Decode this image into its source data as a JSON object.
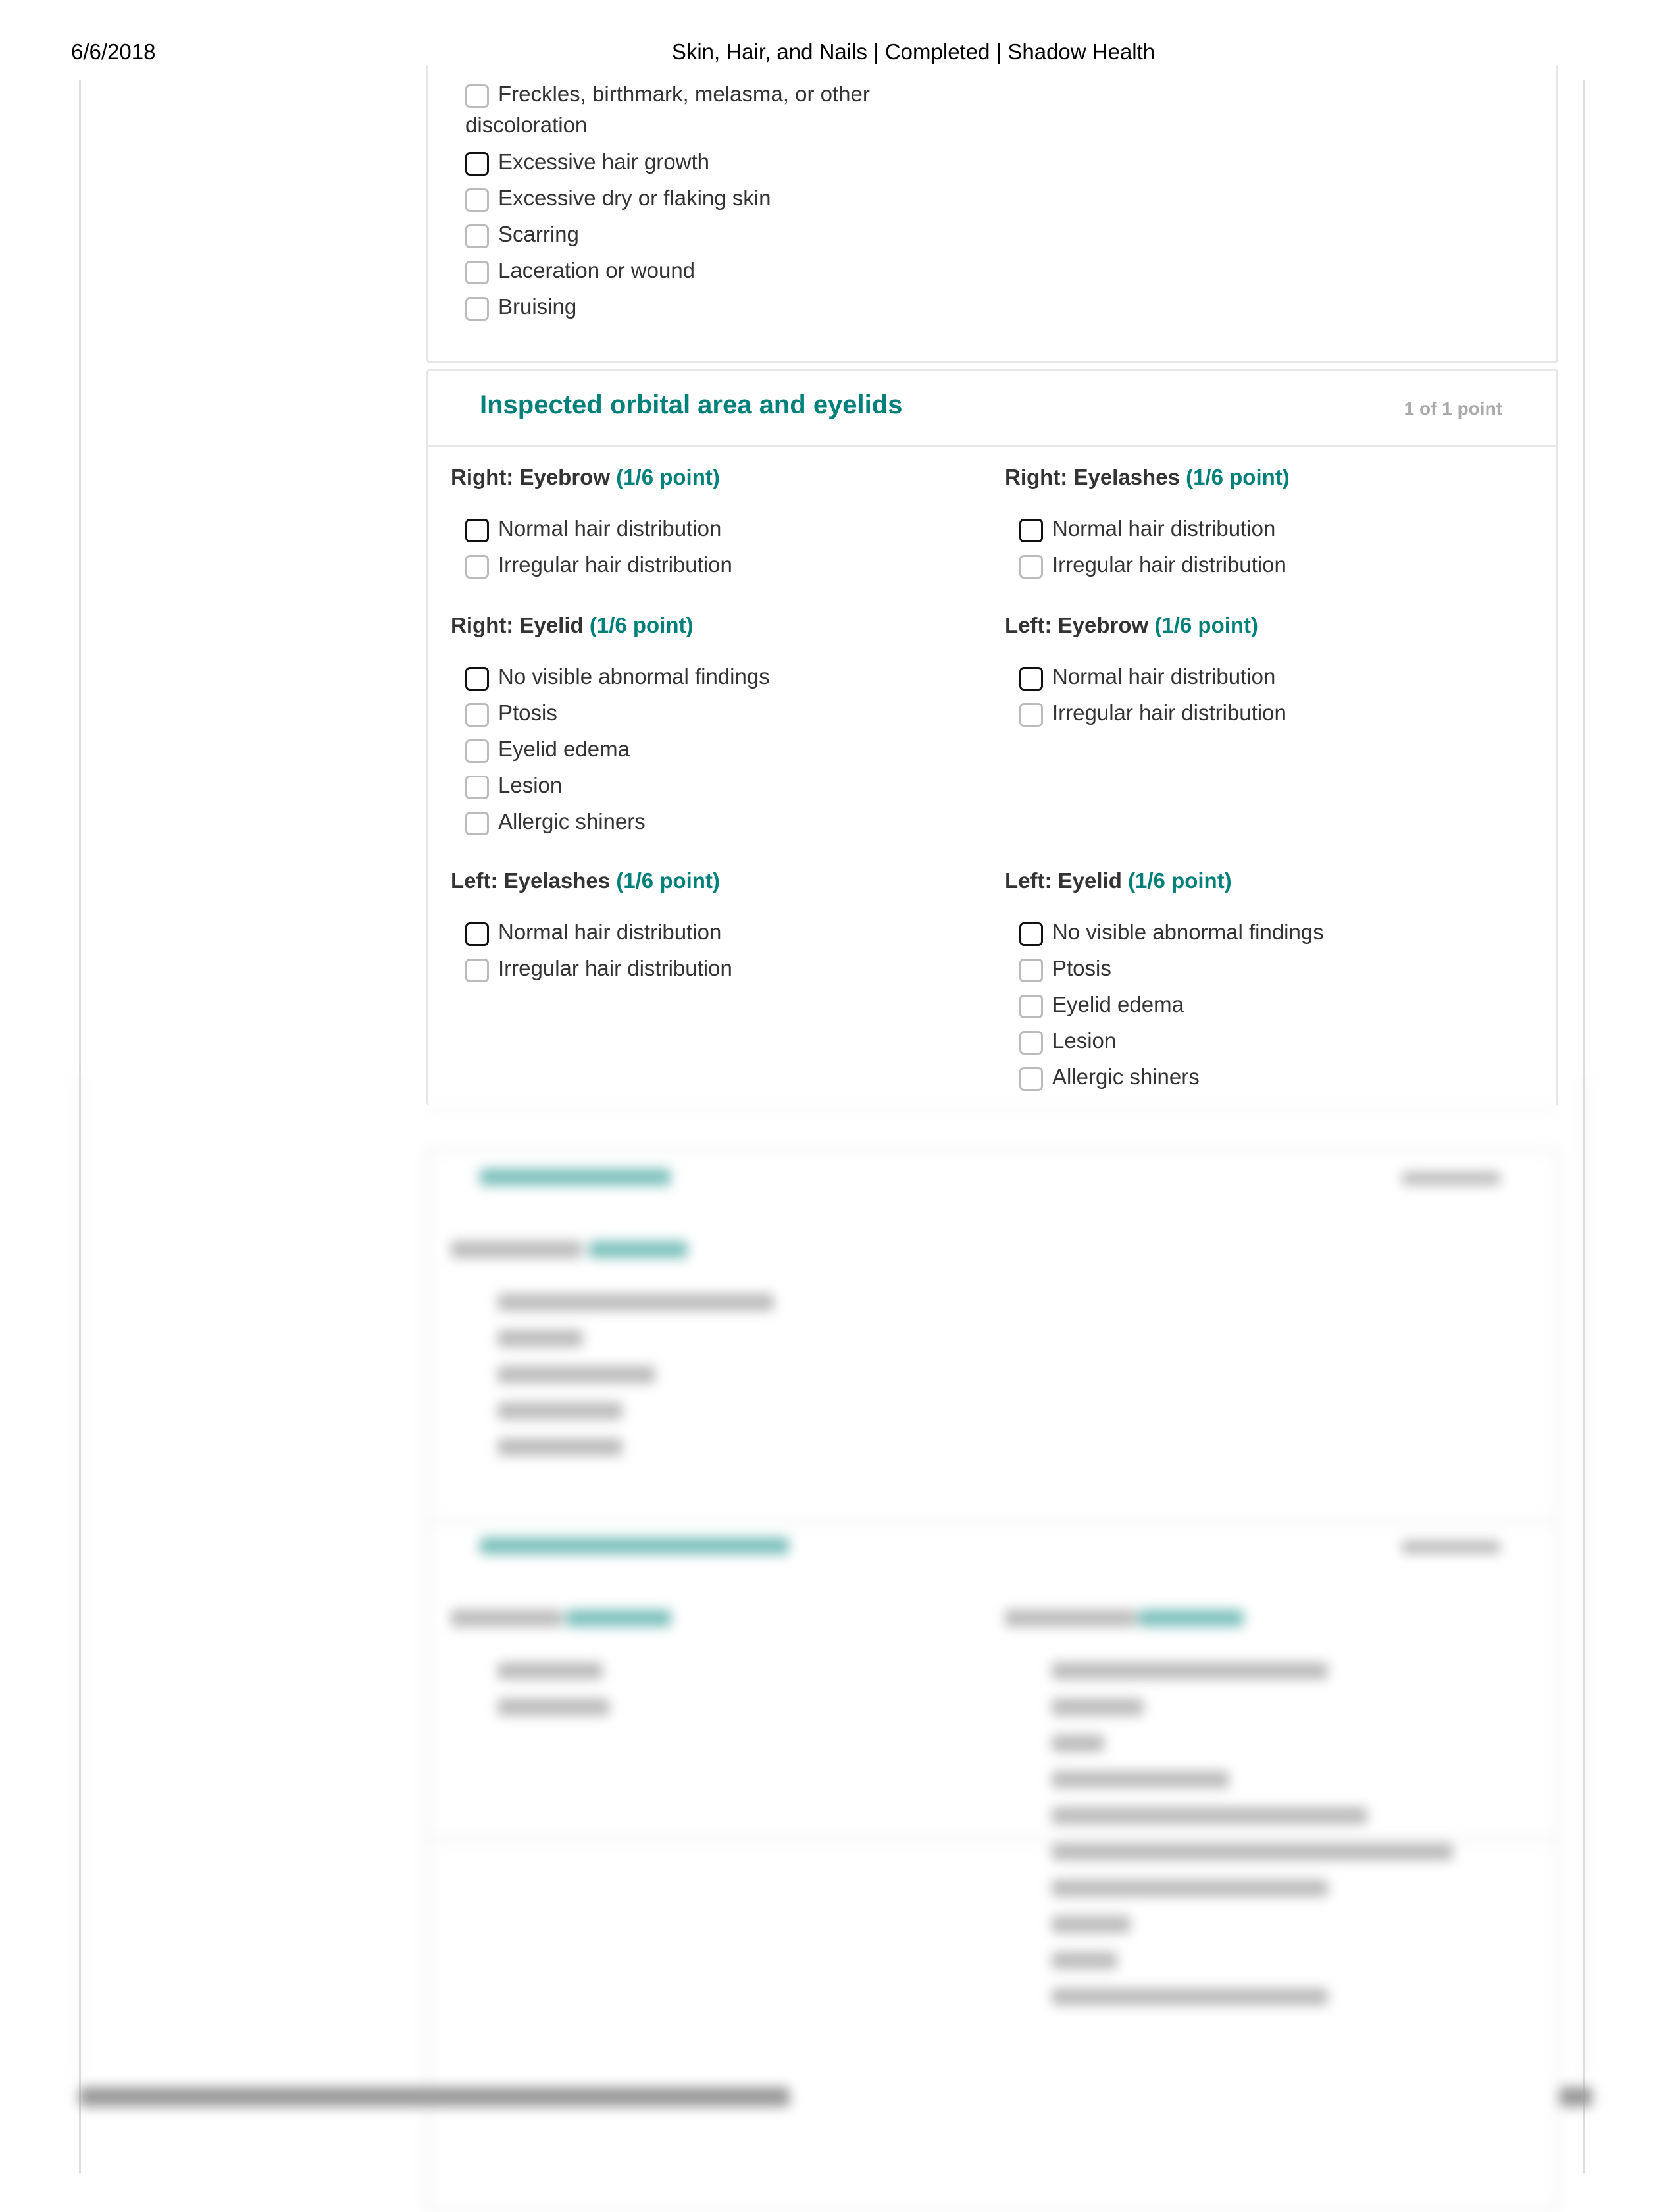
{
  "header": {
    "date": "6/6/2018",
    "title": "Skin, Hair, and Nails | Completed | Shadow Health"
  },
  "prev_card": {
    "items": [
      {
        "label": "Freckles, birthmark, melasma, or other",
        "label2": "discoloration",
        "checked": false
      },
      {
        "label": "Excessive hair growth",
        "checked": true
      },
      {
        "label": "Excessive dry or flaking skin",
        "checked": false
      },
      {
        "label": "Scarring",
        "checked": false
      },
      {
        "label": "Laceration or wound",
        "checked": false
      },
      {
        "label": "Bruising",
        "checked": false
      }
    ]
  },
  "orbital_card": {
    "title": "Inspected orbital area and eyelids",
    "points": "1 of 1 point",
    "groups": [
      {
        "heading": "Right: Eyebrow",
        "points": "(1/6 point)",
        "items": [
          {
            "label": "Normal hair distribution",
            "checked": true
          },
          {
            "label": "Irregular hair distribution",
            "checked": false
          }
        ]
      },
      {
        "heading": "Right: Eyelashes",
        "points": "(1/6 point)",
        "items": [
          {
            "label": "Normal hair distribution",
            "checked": true
          },
          {
            "label": "Irregular hair distribution",
            "checked": false
          }
        ]
      },
      {
        "heading": "Right: Eyelid",
        "points": "(1/6 point)",
        "items": [
          {
            "label": "No visible abnormal findings",
            "checked": true
          },
          {
            "label": "Ptosis",
            "checked": false
          },
          {
            "label": "Eyelid edema",
            "checked": false
          },
          {
            "label": "Lesion",
            "checked": false
          },
          {
            "label": "Allergic shiners",
            "checked": false
          }
        ]
      },
      {
        "heading": "Left: Eyebrow",
        "points": "(1/6 point)",
        "items": [
          {
            "label": "Normal hair distribution",
            "checked": true
          },
          {
            "label": "Irregular hair distribution",
            "checked": false
          }
        ]
      },
      {
        "heading": "Left: Eyelashes",
        "points": "(1/6 point)",
        "items": [
          {
            "label": "Normal hair distribution",
            "checked": true
          },
          {
            "label": "Irregular hair distribution",
            "checked": false
          }
        ]
      },
      {
        "heading": "Left: Eyelid",
        "points": "(1/6 point)",
        "items": [
          {
            "label": "No visible abnormal findings",
            "checked": true
          },
          {
            "label": "Ptosis",
            "checked": false
          },
          {
            "label": "Eyelid edema",
            "checked": false
          },
          {
            "label": "Lesion",
            "checked": false
          },
          {
            "label": "Allergic shiners",
            "checked": false
          }
        ]
      }
    ]
  },
  "colors": {
    "accent": "#00807a",
    "checkbox_checked": "#111111",
    "checkbox_unchecked": "#bbbbbb"
  }
}
